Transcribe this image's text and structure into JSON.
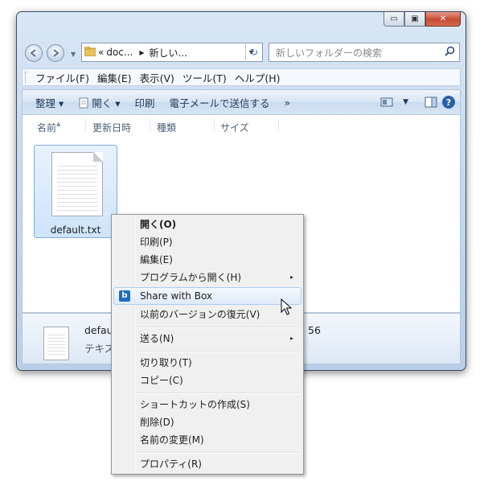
{
  "window": {
    "caption_buttons": {
      "minimize": "▭",
      "maximize": "▣",
      "close": "✕"
    },
    "address": {
      "prefix": "«",
      "crumbs": [
        "doc...",
        "新しい..."
      ],
      "dropdown": "▾",
      "refresh": "↻"
    },
    "search": {
      "placeholder": "新しいフォルダーの検索",
      "icon": "search-icon"
    },
    "menubar": [
      "ファイル(F)",
      "編集(E)",
      "表示(V)",
      "ツール(T)",
      "ヘルプ(H)"
    ],
    "commands": {
      "organize": "整理 ▾",
      "open": "開く ▾",
      "print": "印刷",
      "email": "電子メールで送信する",
      "more": "»"
    },
    "columns": [
      "名前",
      "更新日時",
      "種類",
      "サイズ"
    ],
    "file": {
      "name": "default.txt"
    },
    "details": {
      "name": "defau",
      "type": "テキス",
      "time": "56"
    }
  },
  "context_menu": {
    "items": [
      {
        "label": "開く(O)",
        "bold": true
      },
      {
        "label": "印刷(P)"
      },
      {
        "label": "編集(E)"
      },
      {
        "label": "プログラムから開く(H)",
        "submenu": true
      },
      {
        "label": "Share with Box",
        "highlighted": true,
        "icon": "box-icon"
      },
      {
        "label": "以前のバージョンの復元(V)"
      },
      {
        "label": "送る(N)",
        "submenu": true
      },
      {
        "label": "切り取り(T)"
      },
      {
        "label": "コピー(C)"
      },
      {
        "label": "ショートカットの作成(S)"
      },
      {
        "label": "削除(D)"
      },
      {
        "label": "名前の変更(M)"
      },
      {
        "label": "プロパティ(R)"
      }
    ],
    "submenu_arrow": "▸",
    "box_glyph": "b"
  }
}
